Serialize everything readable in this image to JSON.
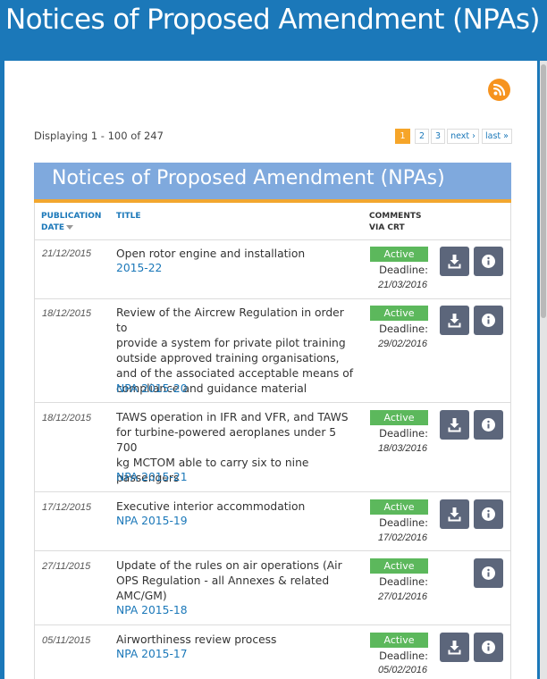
{
  "page": {
    "title": "Notices of Proposed Amendment (NPAs)"
  },
  "listing": {
    "display_count": "Displaying 1 - 100 of 247",
    "pager": {
      "p1": "1",
      "p2": "2",
      "p3": "3",
      "next": "next ›",
      "last": "last »"
    }
  },
  "table": {
    "heading": "Notices of Proposed Amendment (NPAs)",
    "columns": {
      "pub_line1": "PUBLICATION",
      "pub_line2": "DATE",
      "title": "TITLE",
      "comments_line1": "COMMENTS",
      "comments_line2": "VIA CRT"
    },
    "rows": [
      {
        "date": "21/12/2015",
        "lines": [
          "Open rotor engine and installation"
        ],
        "ref": "2015-22",
        "status": "Active",
        "deadline_label": "Deadline:",
        "deadline": "21/03/2016"
      },
      {
        "date": "18/12/2015",
        "lines": [
          "Review of the Aircrew Regulation in order to",
          "provide a system for private pilot training",
          "outside approved training organisations,",
          "and of the associated acceptable means of",
          "compliance and guidance material"
        ],
        "ref": "NPA 2015-20",
        "status": "Active",
        "deadline_label": "Deadline:",
        "deadline": "29/02/2016"
      },
      {
        "date": "18/12/2015",
        "lines": [
          "TAWS operation in IFR and VFR, and TAWS",
          "for turbine-powered aeroplanes under 5 700",
          "kg MCTOM able to carry six to nine",
          "passengers"
        ],
        "ref": "NPA 2015-21",
        "status": "Active",
        "deadline_label": "Deadline:",
        "deadline": "18/03/2016"
      },
      {
        "date": "17/12/2015",
        "lines": [
          "Executive interior accommodation"
        ],
        "ref": "NPA 2015-19",
        "status": "Active",
        "deadline_label": "Deadline:",
        "deadline": "17/02/2016"
      },
      {
        "date": "27/11/2015",
        "lines": [
          "Update of the rules on air operations (Air",
          "OPS Regulation - all Annexes & related",
          "AMC/GM)"
        ],
        "ref": "NPA 2015-18",
        "status": "Active",
        "deadline_label": "Deadline:",
        "deadline": "27/01/2016"
      },
      {
        "date": "05/11/2015",
        "lines": [
          "Airworthiness review process"
        ],
        "ref": "NPA 2015-17",
        "status": "Active",
        "deadline_label": "Deadline:",
        "deadline": "05/02/2016"
      }
    ]
  },
  "colors": {
    "banner": "#1b78b9",
    "table_header": "#7fa9dd",
    "accent_orange": "#f2a72f",
    "active_green": "#5cb85c",
    "button_slate": "#5c667b",
    "rss_orange": "#f6931f"
  },
  "icons": {
    "rss": "rss-icon",
    "download": "download-icon",
    "info": "info-icon",
    "sort": "sort-arrow-icon"
  }
}
